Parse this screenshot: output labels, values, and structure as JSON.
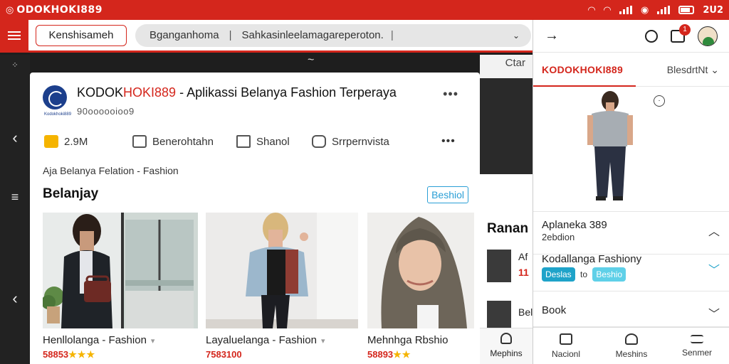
{
  "status_bar": {
    "brand": "ODOKHOKI889",
    "clock": "2U2",
    "battery_level": 0.7
  },
  "app_bar": {
    "title": "Kenshisameh",
    "search": {
      "part1": "Bganganhoma",
      "separator": "|",
      "part2": "Sahkasinleelamagareperoton.",
      "cursor": "|"
    }
  },
  "background": {
    "right_label": "Ctar"
  },
  "post": {
    "title_prefix": "KODOK",
    "title_accent": "HOKI889",
    "title_rest": " - Aplikassi Belanya Fashion Terperaya",
    "subtitle": "90oooooioo9",
    "logo_tag": "Kodokhoki889",
    "actions": [
      {
        "label": "2.9M",
        "icon": "like-icon"
      },
      {
        "label": "Benerohtahn",
        "icon": "document-icon"
      },
      {
        "label": "Shanol",
        "icon": "share-icon"
      },
      {
        "label": "Srrpernvista",
        "icon": "comment-icon"
      }
    ],
    "subline": "Aja Belanya Felation - Fashion",
    "section_title": "Belanjay",
    "badge": "Beshiol",
    "products": [
      {
        "name": "Henllolanga - Fashion",
        "price": "58853",
        "stars": "★★★"
      },
      {
        "name": "Layaluelanga - Fashion",
        "price": "7583100",
        "stars": ""
      },
      {
        "name": "Mehnhga Rbshio",
        "price": "58893",
        "stars": "★★"
      }
    ]
  },
  "side_card": {
    "title": "Ranan",
    "item1_name": "Af",
    "item1_price": "11",
    "item2_name": "Bel",
    "nav_label": "Mephins"
  },
  "panel": {
    "cart_count": "1",
    "tab_active": "KODOKHOKI889",
    "tab_other": "BlesdrtNt",
    "accordions": [
      {
        "title": "Aplaneka 389",
        "sub": "2ebdion",
        "chevron": "up"
      },
      {
        "title": "Kodallanga Fashiony",
        "chip_a": "Deslas",
        "mid": "to",
        "chip_b": "Beshio",
        "chevron": "down"
      },
      {
        "title": "Book",
        "chevron": "down"
      }
    ],
    "nav": [
      {
        "label": "Nacionl",
        "icon": "home-icon"
      },
      {
        "label": "Meshins",
        "icon": "people-icon"
      },
      {
        "label": "Senmer",
        "icon": "list-icon"
      }
    ]
  },
  "colors": {
    "brand_red": "#d4261c",
    "accent_blue": "#2a9fd6",
    "star": "#f5b400"
  }
}
